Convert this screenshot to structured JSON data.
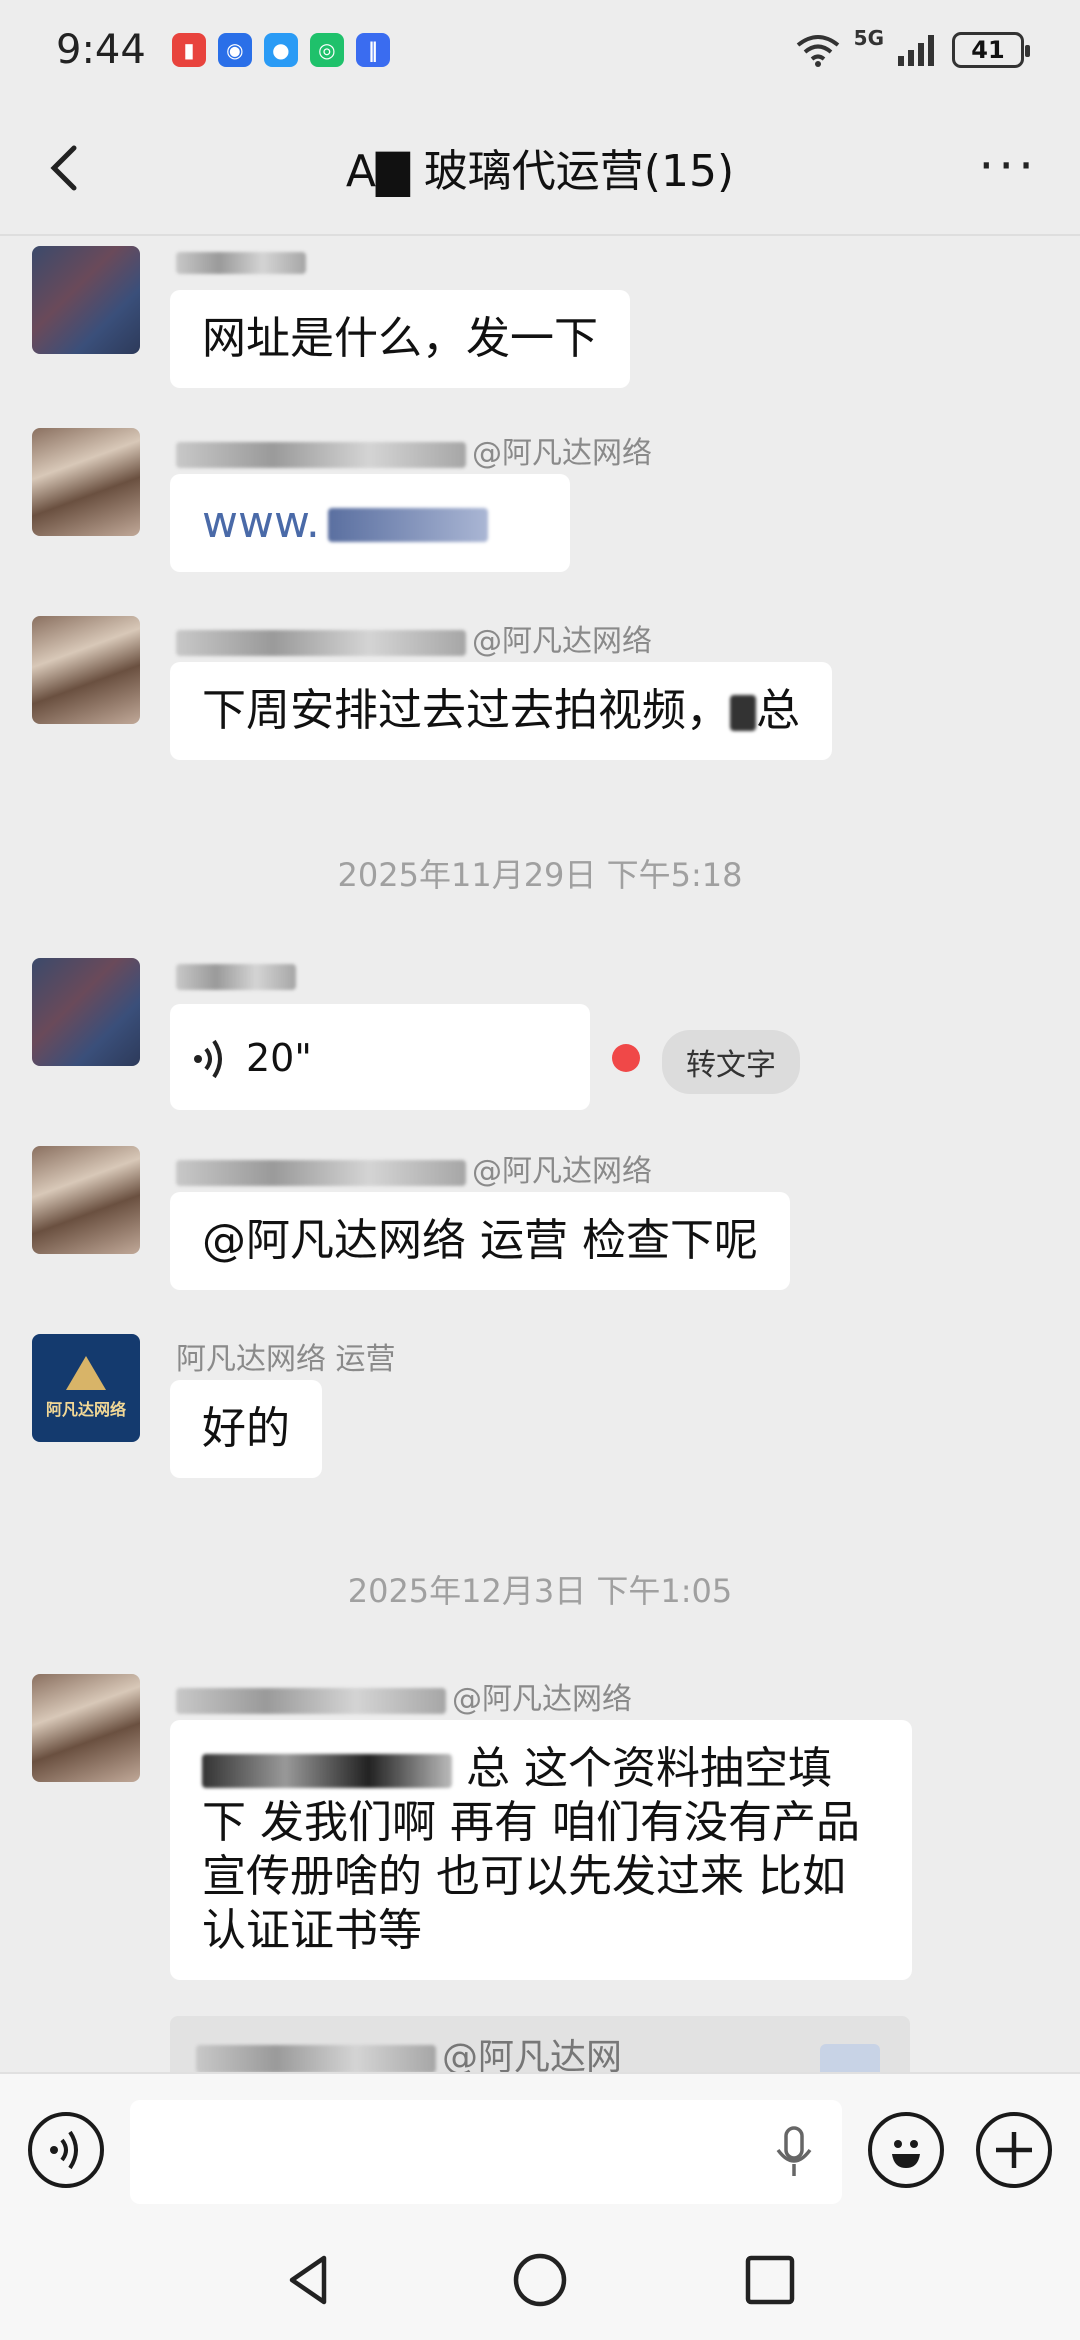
{
  "status_bar": {
    "time": "9:44",
    "network": "5G",
    "battery": "41"
  },
  "header": {
    "title": "A▇  玻璃代运营(15)"
  },
  "messages": [
    {
      "sender": "",
      "text": "网址是什么，发一下"
    },
    {
      "sender": "@阿凡达网络",
      "text": "www."
    },
    {
      "sender": "@阿凡达网络",
      "text": "下周安排过去过去拍视频，",
      "text_suffix": "总"
    },
    {
      "timestamp": "2025年11月29日 下午5:18"
    },
    {
      "sender": "",
      "voice_duration": "20\"",
      "to_text_label": "转文字"
    },
    {
      "sender": "@阿凡达网络",
      "text": "@阿凡达网络 运营  检查下呢"
    },
    {
      "sender": "阿凡达网络 运营",
      "text": "好的",
      "avatar_text": "阿凡达网络"
    },
    {
      "timestamp": "2025年12月3日 下午1:05"
    },
    {
      "sender": "@阿凡达网络",
      "text_lines": [
        "总 这个资料抽空填",
        "下 发我们啊 再有 咱们有没有产品",
        "宣传册啥的 也可以先发过来 比如",
        "认证证书等"
      ]
    },
    {
      "quote_sender": "@阿凡达网"
    }
  ],
  "input": {
    "placeholder": ""
  }
}
